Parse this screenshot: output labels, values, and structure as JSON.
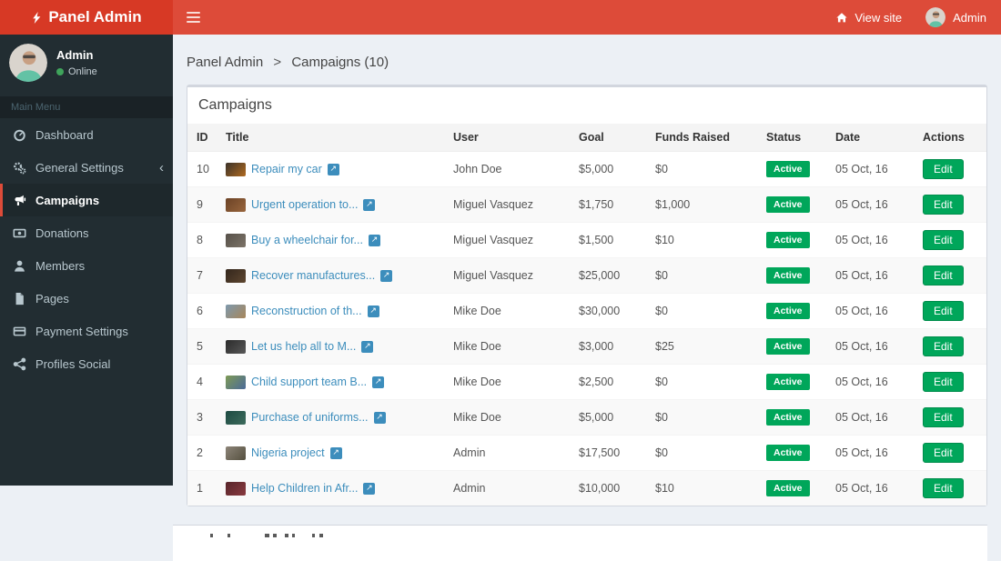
{
  "navbar": {
    "brand": "Panel Admin",
    "view_site_label": "View site",
    "user_label": "Admin"
  },
  "sidebar": {
    "user_name": "Admin",
    "user_status": "Online",
    "section_header": "Main Menu",
    "items": [
      {
        "label": "Dashboard",
        "icon": "dashboard-icon",
        "active": false
      },
      {
        "label": "General Settings",
        "icon": "gears-icon",
        "active": false,
        "chevron": "‹"
      },
      {
        "label": "Campaigns",
        "icon": "bullhorn-icon",
        "active": true
      },
      {
        "label": "Donations",
        "icon": "money-icon",
        "active": false
      },
      {
        "label": "Members",
        "icon": "user-icon",
        "active": false
      },
      {
        "label": "Pages",
        "icon": "file-icon",
        "active": false
      },
      {
        "label": "Payment Settings",
        "icon": "credit-card-icon",
        "active": false
      },
      {
        "label": "Profiles Social",
        "icon": "share-icon",
        "active": false
      }
    ]
  },
  "breadcrumb": {
    "parts": [
      "Panel Admin",
      "Campaigns (10)"
    ],
    "separator": ">"
  },
  "box": {
    "title": "Campaigns",
    "table": {
      "headers": [
        "ID",
        "Title",
        "User",
        "Goal",
        "Funds Raised",
        "Status",
        "Date",
        "Actions"
      ],
      "edit_label": "Edit",
      "external_link_glyph": "↗",
      "rows": [
        {
          "id": "10",
          "title": "Repair my car",
          "user": "John Doe",
          "goal": "$5,000",
          "funds": "$0",
          "status": "Active",
          "date": "05 Oct, 16",
          "thumb": [
            "#3a322a",
            "#b06a20"
          ]
        },
        {
          "id": "9",
          "title": "Urgent operation to...",
          "user": "Miguel Vasquez",
          "goal": "$1,750",
          "funds": "$1,000",
          "status": "Active",
          "date": "05 Oct, 16",
          "thumb": [
            "#6b4226",
            "#99663d"
          ]
        },
        {
          "id": "8",
          "title": "Buy a wheelchair for...",
          "user": "Miguel Vasquez",
          "goal": "$1,500",
          "funds": "$10",
          "status": "Active",
          "date": "05 Oct, 16",
          "thumb": [
            "#565049",
            "#7d7468"
          ]
        },
        {
          "id": "7",
          "title": "Recover manufactures...",
          "user": "Miguel Vasquez",
          "goal": "$25,000",
          "funds": "$0",
          "status": "Active",
          "date": "05 Oct, 16",
          "thumb": [
            "#33261c",
            "#5e4630"
          ]
        },
        {
          "id": "6",
          "title": "Reconstruction of th...",
          "user": "Mike Doe",
          "goal": "$30,000",
          "funds": "$0",
          "status": "Active",
          "date": "05 Oct, 16",
          "thumb": [
            "#7d99ad",
            "#a8865a"
          ]
        },
        {
          "id": "5",
          "title": "Let us help all to M...",
          "user": "Mike Doe",
          "goal": "$3,000",
          "funds": "$25",
          "status": "Active",
          "date": "05 Oct, 16",
          "thumb": [
            "#2b2b2b",
            "#585858"
          ]
        },
        {
          "id": "4",
          "title": "Child support team B...",
          "user": "Mike Doe",
          "goal": "$2,500",
          "funds": "$0",
          "status": "Active",
          "date": "05 Oct, 16",
          "thumb": [
            "#7e9a55",
            "#4a6a99"
          ]
        },
        {
          "id": "3",
          "title": "Purchase of uniforms...",
          "user": "Mike Doe",
          "goal": "$5,000",
          "funds": "$0",
          "status": "Active",
          "date": "05 Oct, 16",
          "thumb": [
            "#1d4a42",
            "#3d6b5c"
          ]
        },
        {
          "id": "2",
          "title": "Nigeria project",
          "user": "Admin",
          "goal": "$17,500",
          "funds": "$0",
          "status": "Active",
          "date": "05 Oct, 16",
          "thumb": [
            "#8c8478",
            "#55503f"
          ]
        },
        {
          "id": "1",
          "title": "Help Children in Afr...",
          "user": "Admin",
          "goal": "$10,000",
          "funds": "$10",
          "status": "Active",
          "date": "05 Oct, 16",
          "thumb": [
            "#57252a",
            "#8a3a40"
          ]
        }
      ]
    }
  },
  "colors": {
    "navbar_red": "#dd4b39",
    "logo_red": "#d73925",
    "sidebar_dark": "#222d32",
    "active_green": "#00a65a",
    "link_blue": "#3c8dbc",
    "content_bg": "#ecf0f5"
  }
}
